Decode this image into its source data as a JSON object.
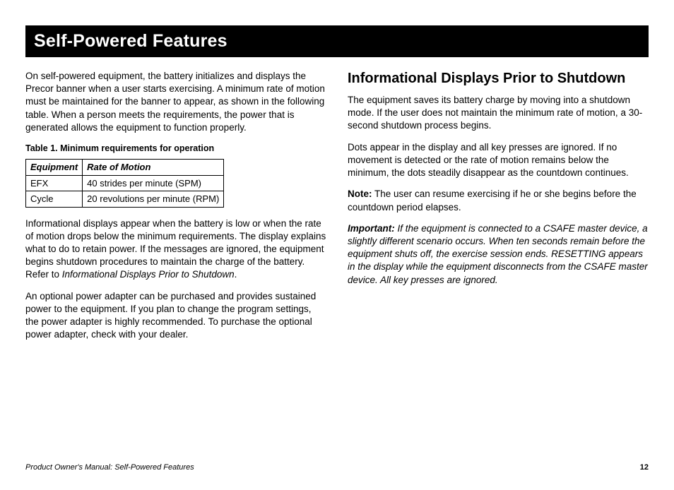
{
  "title": "Self-Powered Features",
  "left": {
    "p1": "On self-powered equipment, the battery initializes and displays the Precor banner when a user starts exercising. A minimum rate of motion must be maintained for the banner to appear, as shown in the following table. When a person meets the requirements, the power that is generated allows the equipment to function properly.",
    "table_caption": "Table  1.  Minimum requirements for operation",
    "table_h1": "Equipment",
    "table_h2": "Rate of Motion",
    "r1c1": "EFX",
    "r1c2": "40 strides per minute (SPM)",
    "r2c1": "Cycle",
    "r2c2": "20 revolutions per minute (RPM)",
    "p2a": "Informational displays appear when the battery is low or when the rate of motion drops below the minimum requirements. The display explains what to do to retain power. If the messages are ignored, the equipment begins shutdown procedures to maintain the charge of the battery. Refer to ",
    "p2b": "Informational Displays Prior to Shutdown",
    "p2c": ".",
    "p3": "An optional power adapter can be purchased and provides sustained power to the equipment. If you plan to change the program settings, the power adapter is highly recommended. To purchase the optional power adapter, check with your dealer."
  },
  "right": {
    "heading": "Informational Displays Prior to Shutdown",
    "p1": "The equipment saves its battery charge by moving into a shutdown mode. If the user does not maintain the minimum rate of motion, a 30-second shutdown process begins.",
    "p2": "Dots appear in the display and all key presses are ignored. If no movement is detected or the rate of motion remains below the minimum, the dots steadily disappear as the countdown continues.",
    "note_label": "Note:",
    "note_text": " The user can resume exercising if he or she begins before the countdown period elapses.",
    "imp_label": "Important:",
    "imp_text": " If the equipment is connected to a CSAFE master device, a slightly different scenario occurs. When ten seconds remain before the equipment shuts off, the exercise session ends. RESETTING appears in the display while the equipment disconnects from the CSAFE master device. All key presses are ignored."
  },
  "footer": {
    "left": "Product Owner's Manual: Self-Powered Features",
    "page": "12"
  }
}
